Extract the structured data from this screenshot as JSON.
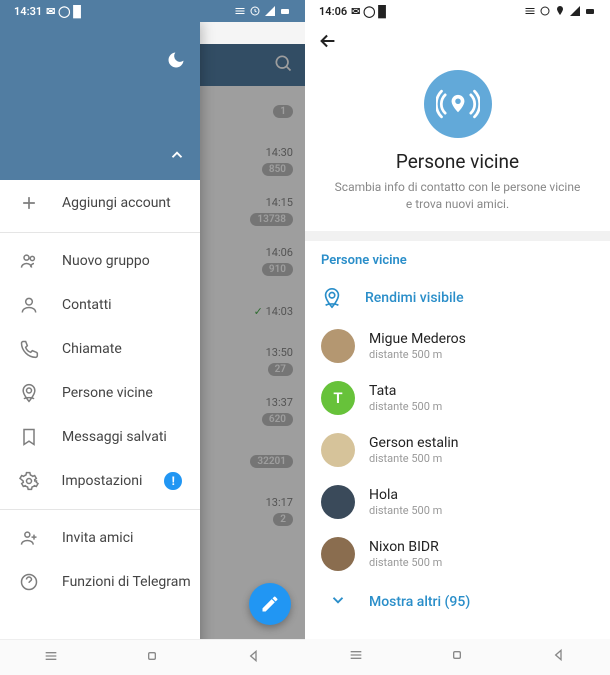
{
  "left": {
    "time": "14:31",
    "drawer": {
      "add_account": "Aggiungi account",
      "items": [
        "Nuovo gruppo",
        "Contatti",
        "Chiamate",
        "Persone vicine",
        "Messaggi salvati",
        "Impostazioni"
      ],
      "badge": "!",
      "invite": "Invita amici",
      "faq": "Funzioni di Telegram"
    },
    "chats": [
      {
        "time": null,
        "count": "1"
      },
      {
        "time": "14:30",
        "count": "850"
      },
      {
        "time": "14:15",
        "count": "13738"
      },
      {
        "time": "14:06",
        "count": "910"
      },
      {
        "time": "14:03",
        "count": null,
        "tick": true
      },
      {
        "time": "13:50",
        "count": "27"
      },
      {
        "time": "13:37",
        "count": "620"
      },
      {
        "time": null,
        "count": "32201"
      },
      {
        "time": "13:17",
        "count": "2"
      }
    ]
  },
  "right": {
    "time": "14:06",
    "title": "Persone vicine",
    "subtitle": "Scambia info di contatto con le persone vicine e trova nuovi amici.",
    "section_title": "Persone vicine",
    "make_visible": "Rendimi visibile",
    "people": [
      {
        "name": "Migue Mederos",
        "dist": "distante 500 m",
        "color": "#b49771",
        "initial": ""
      },
      {
        "name": "Tata",
        "dist": "distante 500 m",
        "color": "#67c23a",
        "initial": "T"
      },
      {
        "name": "Gerson estalin",
        "dist": "distante 500 m",
        "color": "#d6c39a",
        "initial": ""
      },
      {
        "name": "Hola",
        "dist": "distante 500 m",
        "color": "#3a4a5a",
        "initial": ""
      },
      {
        "name": "Nixon BIDR",
        "dist": "distante 500 m",
        "color": "#8a6d4f",
        "initial": ""
      }
    ],
    "show_more": "Mostra altri (95)"
  }
}
